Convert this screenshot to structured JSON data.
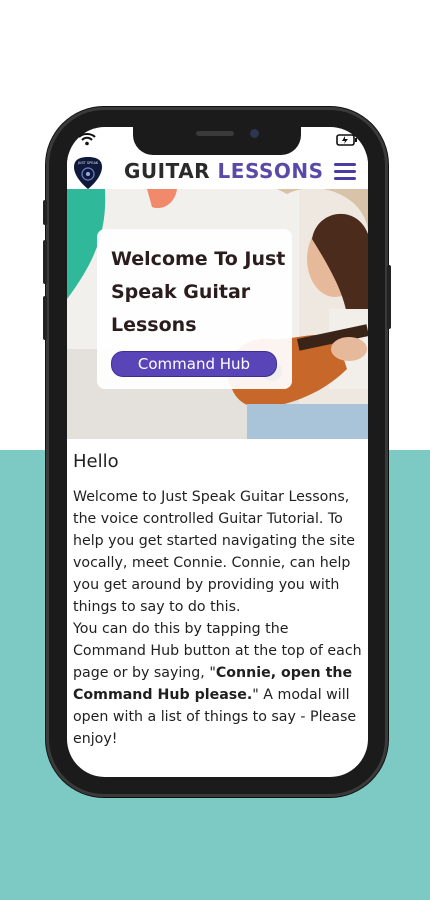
{
  "header": {
    "title_part1": "GUITAR",
    "title_part2": "LESSONS",
    "logo_text": "JUST SPEAK",
    "menu_icon": "hamburger-menu-icon"
  },
  "hero": {
    "title": "Welcome To Just Speak Guitar Lessons",
    "button_label": "Command Hub"
  },
  "content": {
    "heading": "Hello",
    "paragraph_intro": "Welcome to Just Speak Guitar Lessons, the voice controlled Guitar Tutorial. To help you get started navigating the site vocally, meet Connie. Connie, can help you get around by providing you with things to say to do this.",
    "paragraph_part2": " You can do this by tapping the Command Hub button at the top of each page or by saying, \"",
    "paragraph_bold": "Connie, open the Command Hub please.",
    "paragraph_part3": "\" A modal will open with a list of things to say - Please enjoy!"
  },
  "status_bar": {
    "wifi_icon": "wifi-icon",
    "battery_icon": "battery-icon"
  },
  "colors": {
    "teal_background": "#7ccac3",
    "accent_purple": "#5a45b8",
    "title_purple": "#5a4aa8"
  }
}
